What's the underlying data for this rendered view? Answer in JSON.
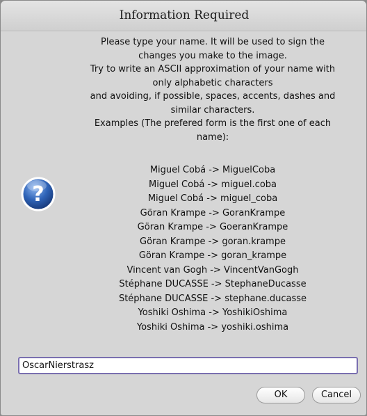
{
  "dialog": {
    "title": "Information Required",
    "icon": "question-icon",
    "message_lines": [
      "Please type your name. It will be used to sign the",
      "changes you make to the image.",
      "Try to write an ASCII approximation of your name with",
      "only alphabetic characters",
      "and avoiding, if possible, spaces, accents, dashes and",
      "similar characters.",
      "Examples (The prefered form is the first one of each",
      "name):"
    ],
    "examples": [
      "Miguel Cobá -> MiguelCoba",
      "Miguel Cobá -> miguel.coba",
      "Miguel Cobá -> miguel_coba",
      "Göran Krampe -> GoranKrampe",
      "Göran Krampe -> GoeranKrampe",
      "Göran Krampe -> goran.krampe",
      "Göran Krampe -> goran_krampe",
      "Vincent van Gogh -> VincentVanGogh",
      "Stéphane DUCASSE -> StephaneDucasse",
      "Stéphane DUCASSE -> stephane.ducasse",
      "Yoshiki Oshima -> YoshikiOshima",
      "Yoshiki Oshima -> yoshiki.oshima"
    ],
    "input_value": "OscarNierstrasz",
    "ok_label": "OK",
    "cancel_label": "Cancel"
  },
  "colors": {
    "icon_blue": "#2f64b8",
    "input_border": "#7a6fb0",
    "background": "#d6d6d6"
  }
}
